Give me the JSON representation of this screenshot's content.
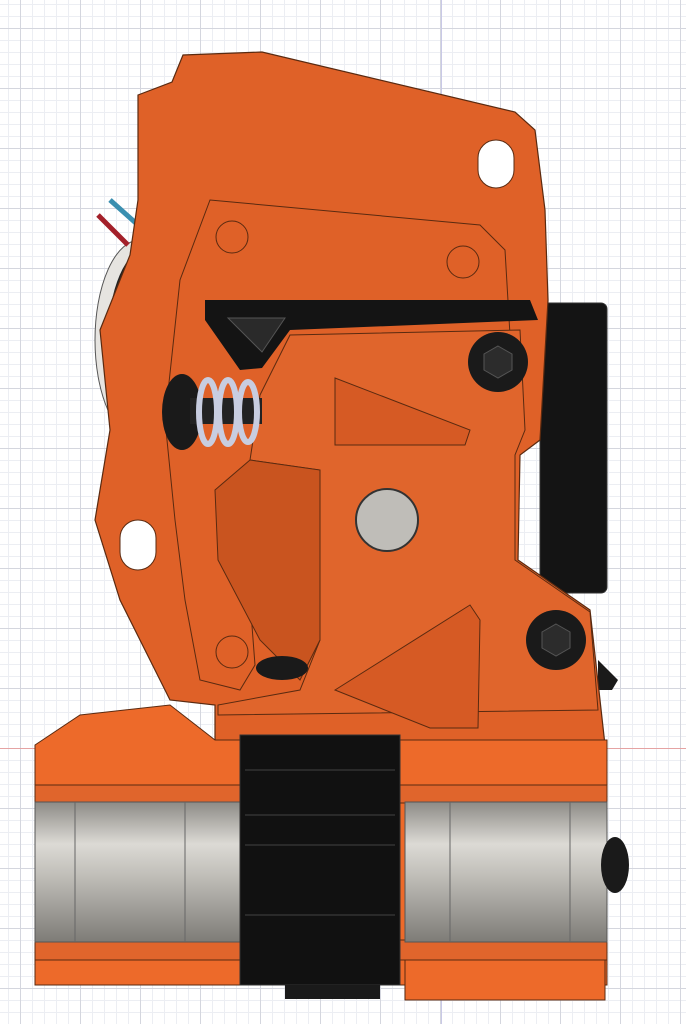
{
  "viewport": {
    "colors": {
      "body": "#df6128",
      "body_dark": "#c9541f",
      "outline": "#5a2a10",
      "black": "#141414",
      "steel": "#b9b7b1",
      "steel_light": "#d6d4cf",
      "grid_axis": "#e5a3a3"
    }
  }
}
